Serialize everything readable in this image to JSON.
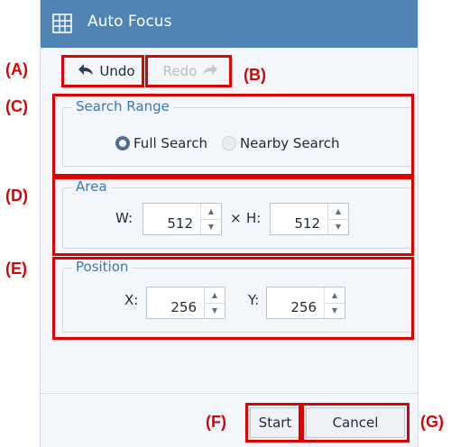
{
  "window": {
    "title": "Auto Focus",
    "title_icon": "grid-icon"
  },
  "toolbar": {
    "undo_label": "Undo",
    "redo_label": "Redo"
  },
  "search_range": {
    "legend": "Search Range",
    "options": [
      {
        "label": "Full Search",
        "selected": true
      },
      {
        "label": "Nearby Search",
        "selected": false
      }
    ]
  },
  "area": {
    "legend": "Area",
    "w_label": "W:",
    "w_value": "512",
    "times": "×",
    "h_label": "H:",
    "h_value": "512"
  },
  "position": {
    "legend": "Position",
    "x_label": "X:",
    "x_value": "256",
    "y_label": "Y:",
    "y_value": "256"
  },
  "footer": {
    "start_label": "Start",
    "cancel_label": "Cancel"
  },
  "annotations": {
    "a": "(A)",
    "b": "(B)",
    "c": "(C)",
    "d": "(D)",
    "e": "(E)",
    "f": "(F)",
    "g": "(G)"
  },
  "colors": {
    "titlebar": "#4f84b4",
    "accent": "#3b78b0",
    "highlight": "#e00000"
  }
}
